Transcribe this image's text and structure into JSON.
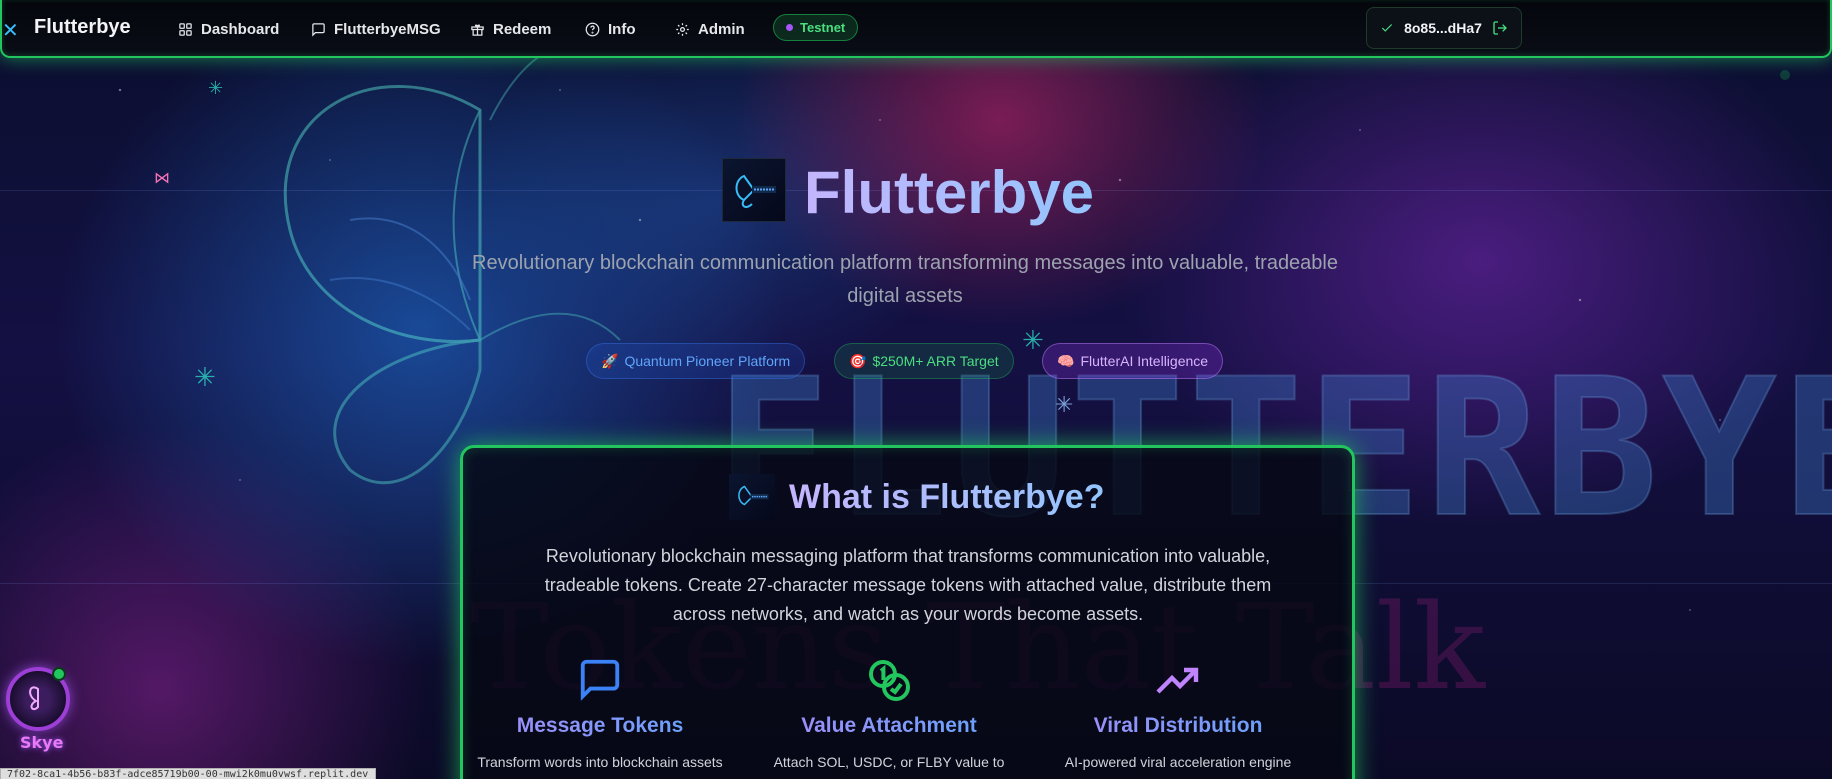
{
  "navbar": {
    "brand": "Flutterbye",
    "items": [
      {
        "label": "Dashboard",
        "icon": "dashboard-icon"
      },
      {
        "label": "FlutterbyeMSG",
        "icon": "message-icon"
      },
      {
        "label": "Redeem",
        "icon": "gift-icon"
      },
      {
        "label": "Info",
        "icon": "info-icon"
      },
      {
        "label": "Admin",
        "icon": "gear-icon"
      }
    ],
    "network_badge": "Testnet",
    "wallet_address": "8o85...dHa7"
  },
  "hero": {
    "title": "Flutterbye",
    "subtitle": "Revolutionary blockchain communication platform transforming messages into valuable, tradeable digital assets",
    "pills": [
      {
        "emoji": "🚀",
        "label": "Quantum Pioneer Platform"
      },
      {
        "emoji": "🎯",
        "label": "$250M+ ARR Target"
      },
      {
        "emoji": "🧠",
        "label": "FlutterAI Intelligence"
      }
    ],
    "background_word": "FLUTTERBYE",
    "background_tagline": "Tokens That Talk"
  },
  "card": {
    "title": "What is Flutterbye?",
    "description": "Revolutionary blockchain messaging platform that transforms communication into valuable, tradeable tokens. Create 27-character message tokens with attached value, distribute them across networks, and watch as your words become assets.",
    "features": [
      {
        "title": "Message Tokens",
        "icon": "chat-bubble-icon",
        "text": "Transform words into blockchain assets"
      },
      {
        "title": "Value Attachment",
        "icon": "coins-icon",
        "text": "Attach SOL, USDC, or FLBY value to"
      },
      {
        "title": "Viral Distribution",
        "icon": "trending-up-icon",
        "text": "AI-powered viral acceleration engine"
      }
    ]
  },
  "assistant": {
    "label": "Skye"
  },
  "status_bar": {
    "url": "7f02-8ca1-4b56-b83f-adce85719b00-00-mwi2k0mu0vwsf.replit.dev"
  },
  "colors": {
    "accent_green": "#22c55e",
    "brand_purple": "#a78bfa",
    "brand_blue": "#60a5fa"
  }
}
